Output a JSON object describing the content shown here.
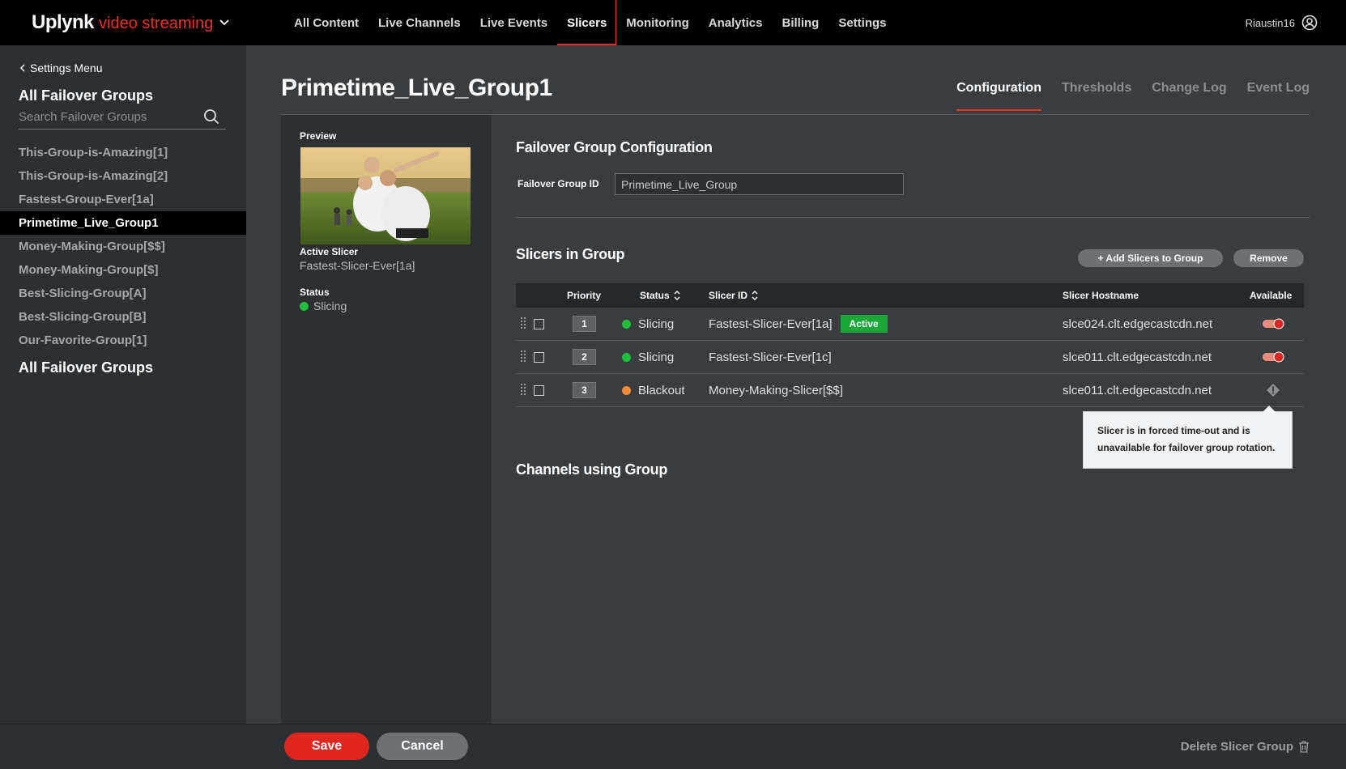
{
  "header": {
    "brand_name": "Uplynk",
    "brand_sub": "video streaming",
    "nav": [
      "All Content",
      "Live Channels",
      "Live Events",
      "Slicers",
      "Monitoring",
      "Analytics",
      "Billing",
      "Settings"
    ],
    "active_nav": "Slicers",
    "username": "Riaustin16"
  },
  "sidebar": {
    "back_label": "Settings Menu",
    "title": "All Failover Groups",
    "search_placeholder": "Search Failover Groups",
    "groups": [
      "This-Group-is-Amazing[1]",
      "This-Group-is-Amazing[2]",
      "Fastest-Group-Ever[1a]",
      "Primetime_Live_Group1",
      "Money-Making-Group[$$]",
      "Money-Making-Group[$]",
      "Best-Slicing-Group[A]",
      "Best-Slicing-Group[B]",
      "Our-Favorite-Group[1]"
    ],
    "selected_group": "Primetime_Live_Group1",
    "footer_title": "All Failover Groups"
  },
  "page": {
    "title": "Primetime_Live_Group1",
    "tabs": [
      "Configuration",
      "Thresholds",
      "Change Log",
      "Event Log"
    ],
    "active_tab": "Configuration"
  },
  "preview": {
    "label": "Preview",
    "active_slicer_label": "Active Slicer",
    "active_slicer_value": "Fastest-Slicer-Ever[1a]",
    "status_label": "Status",
    "status_value": "Slicing"
  },
  "config": {
    "title": "Failover Group Configuration",
    "group_id_label": "Failover Group ID",
    "group_id_value": "Primetime_Live_Group"
  },
  "slicers": {
    "title": "Slicers in Group",
    "add_button": "+ Add Slicers to Group",
    "remove_button": "Remove",
    "columns": {
      "priority": "Priority",
      "status": "Status",
      "slicer_id": "Slicer ID",
      "hostname": "Slicer Hostname",
      "available": "Available"
    },
    "rows": [
      {
        "priority": "1",
        "status": "Slicing",
        "status_color": "#1fbe3c",
        "slicer_id": "Fastest-Slicer-Ever[1a]",
        "badge": "Active",
        "hostname": "slce024.clt.edgecastcdn.net",
        "available": "on"
      },
      {
        "priority": "2",
        "status": "Slicing",
        "status_color": "#1fbe3c",
        "slicer_id": "Fastest-Slicer-Ever[1c]",
        "badge": "",
        "hostname": "slce011.clt.edgecastcdn.net",
        "available": "on"
      },
      {
        "priority": "3",
        "status": "Blackout",
        "status_color": "#f08d3a",
        "slicer_id": "Money-Making-Slicer[$$]",
        "badge": "",
        "hostname": "slce011.clt.edgecastcdn.net",
        "available": "warning"
      }
    ],
    "tooltip": "Slicer is in forced time-out and is unavailable for failover group rotation."
  },
  "channels": {
    "title": "Channels using Group"
  },
  "footer": {
    "save_label": "Save",
    "cancel_label": "Cancel",
    "delete_label": "Delete Slicer Group"
  },
  "colors": {
    "accent": "#e63329",
    "status_ok": "#1fbe3c",
    "status_warn": "#f08d3a",
    "active_badge": "#1aa83a"
  }
}
